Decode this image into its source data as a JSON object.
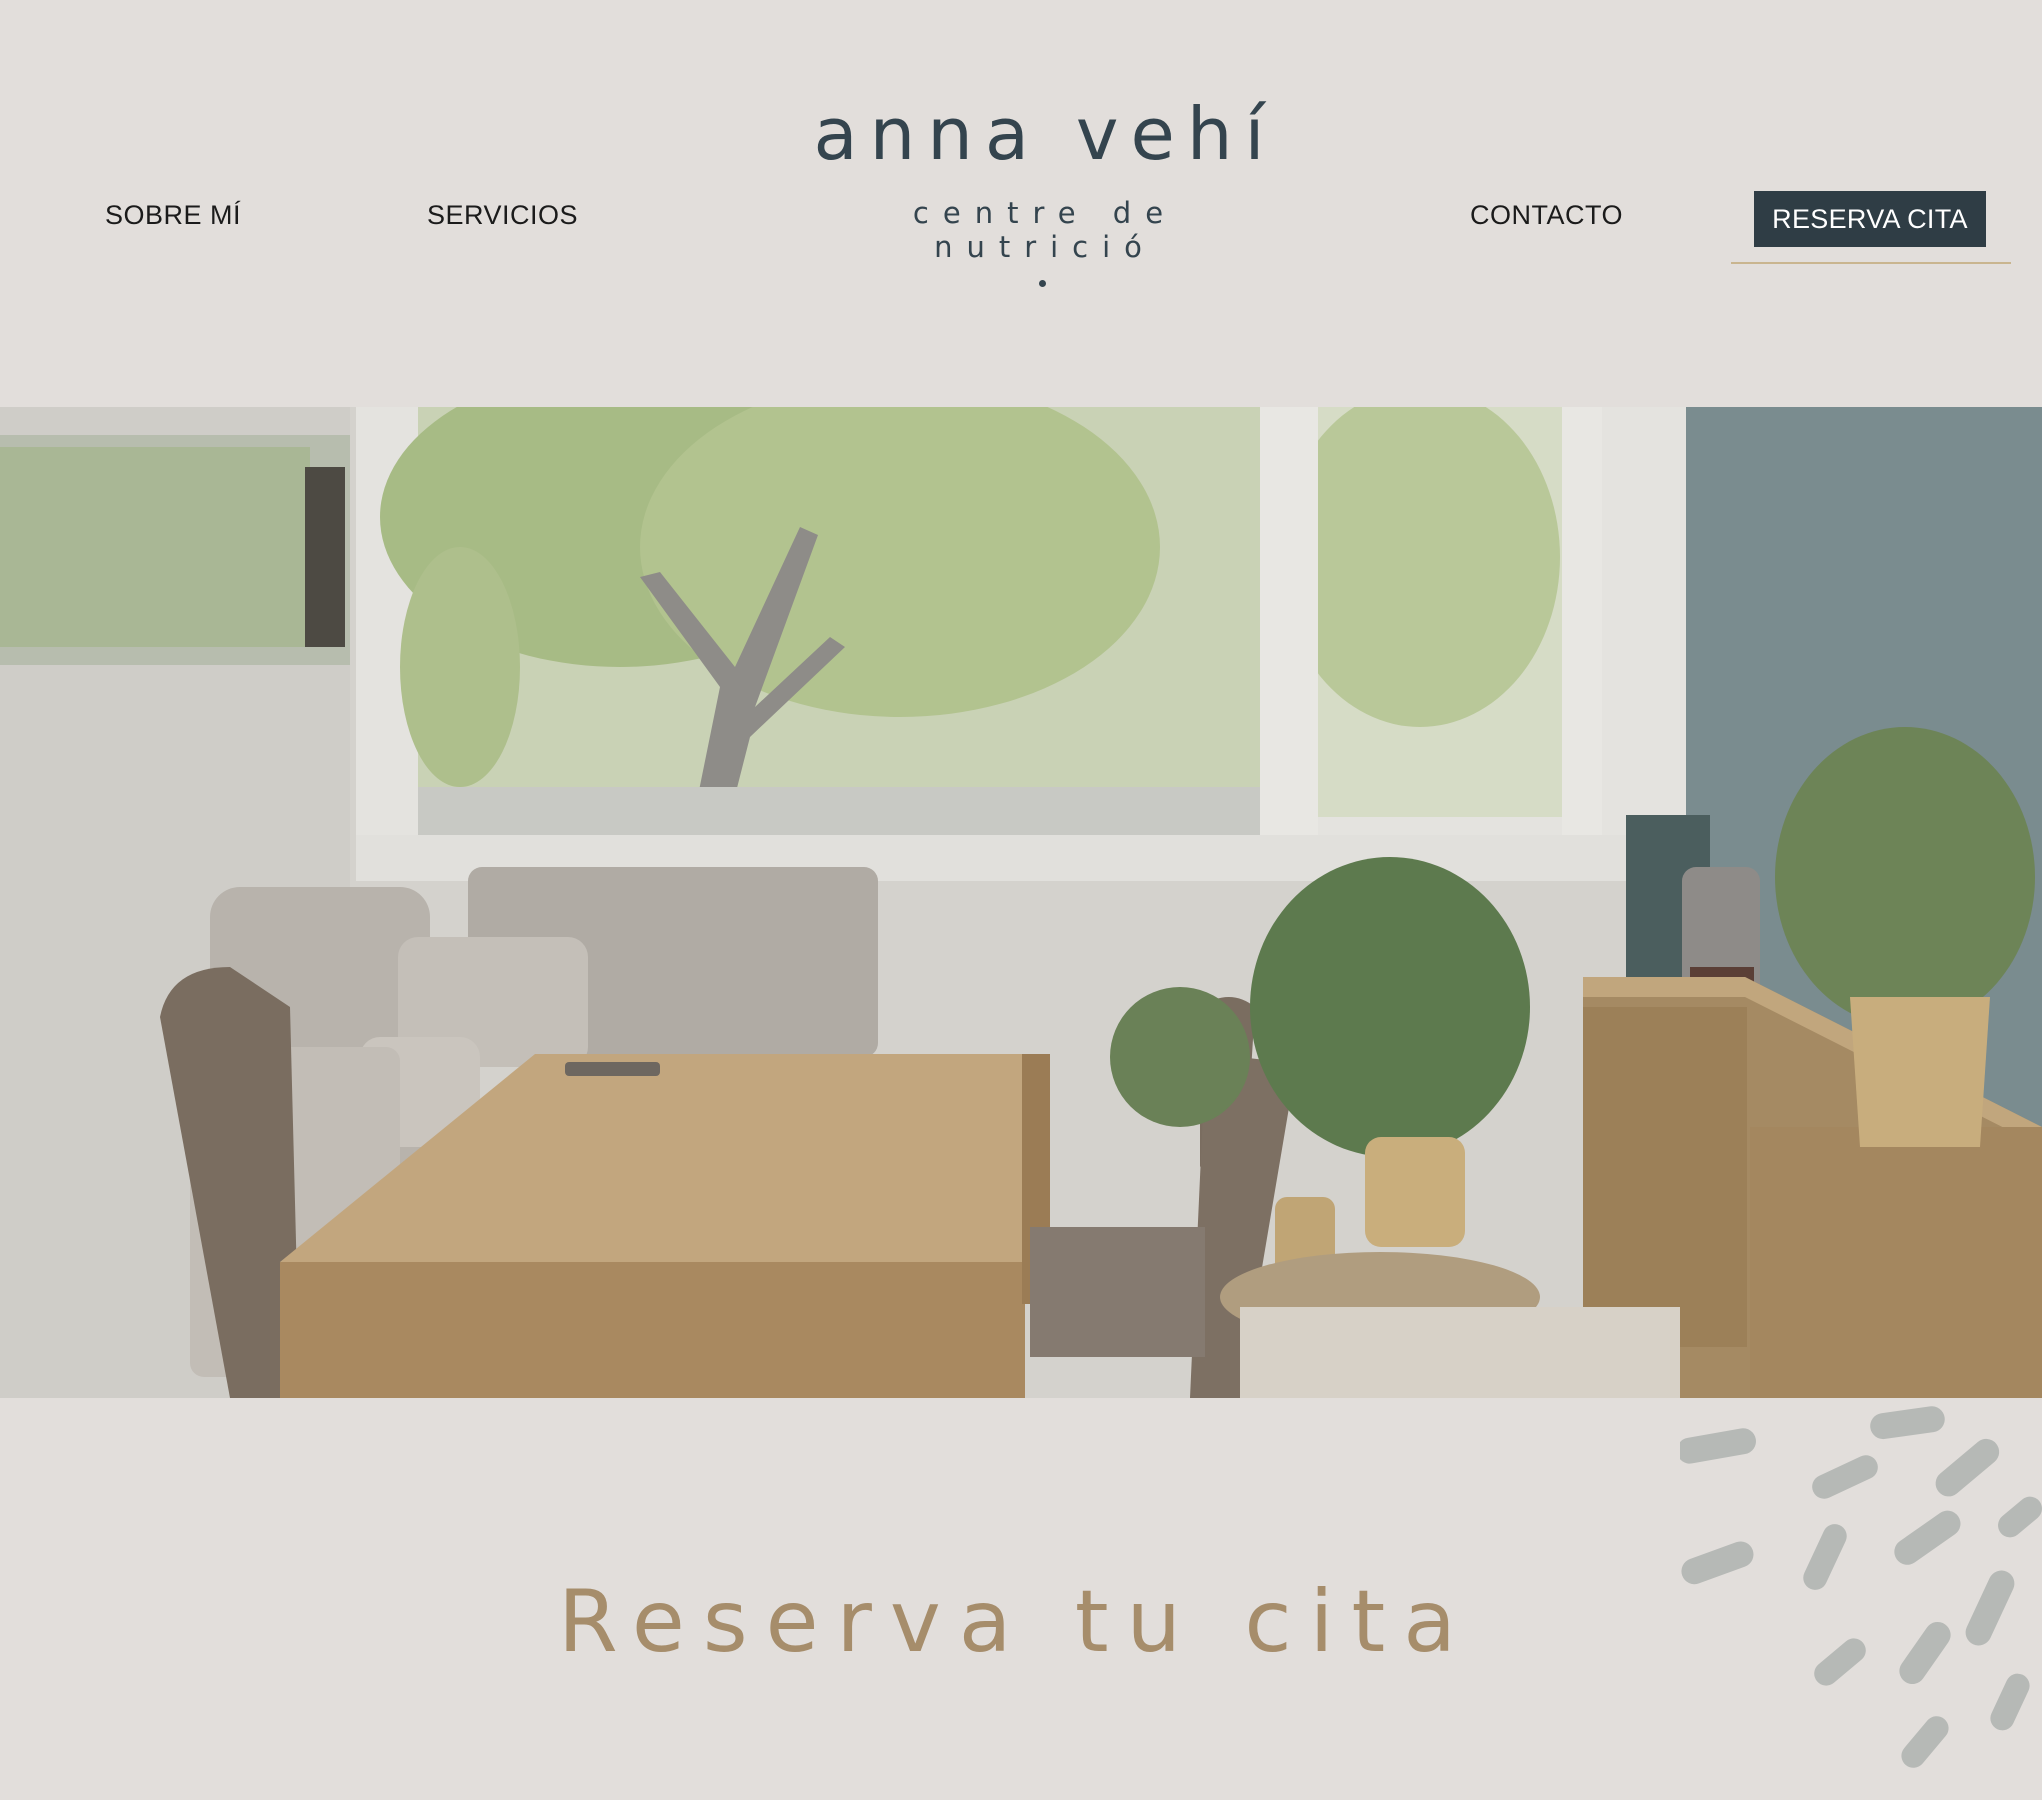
{
  "nav": {
    "left": [
      "SOBRE MÍ",
      "SERVICIOS"
    ],
    "right": [
      "CONTACTO"
    ],
    "cta_label": "RESERVA CITA"
  },
  "logo": {
    "name": "anna vehí",
    "subtitle": "centre de nutrició"
  },
  "hero": {
    "image_icon": "office-interior-photo"
  },
  "section": {
    "heading": "Reserva tu cita"
  },
  "colors": {
    "background": "#e2dedb",
    "logo": "#34444e",
    "button": "#2f3d45",
    "accent_line": "#c9b58f",
    "heading": "#a68d6b",
    "decor": "#b6b9b6"
  }
}
